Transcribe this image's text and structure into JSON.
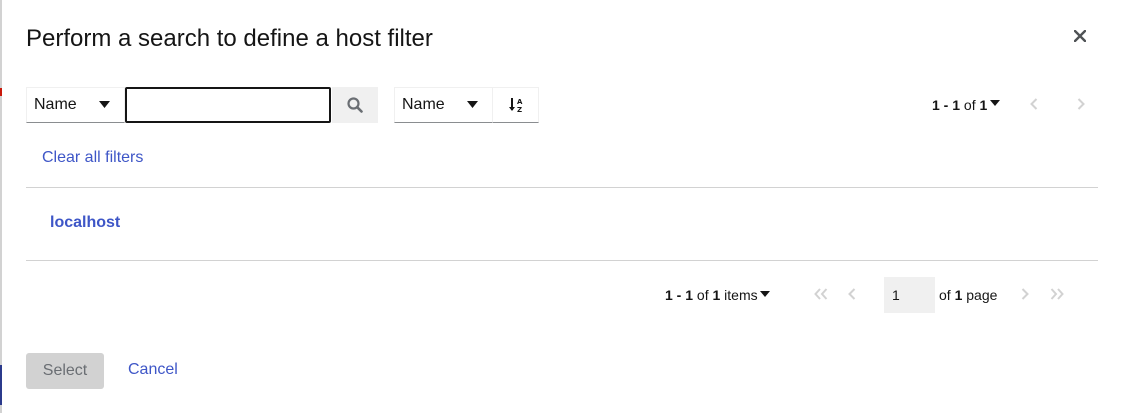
{
  "modal": {
    "title": "Perform a search to define a host filter"
  },
  "toolbar": {
    "filter_attribute": "Name",
    "search_value": "",
    "sort_attribute": "Name",
    "top_pagination": {
      "range": "1 - 1",
      "of_label": "of",
      "total": "1"
    },
    "clear_filters_label": "Clear all filters"
  },
  "results": {
    "items": [
      {
        "name": "localhost"
      }
    ]
  },
  "bottom_pagination": {
    "range": "1 - 1",
    "of_label": "of",
    "total": "1",
    "items_label": "items",
    "page_value": "1",
    "of_page_prefix": "of",
    "page_count": "1",
    "page_label": "page"
  },
  "footer": {
    "select_label": "Select",
    "cancel_label": "Cancel"
  },
  "colors": {
    "link": "#3e56c7",
    "disabled_bg": "#d2d2d2",
    "border": "#8a8d90"
  }
}
